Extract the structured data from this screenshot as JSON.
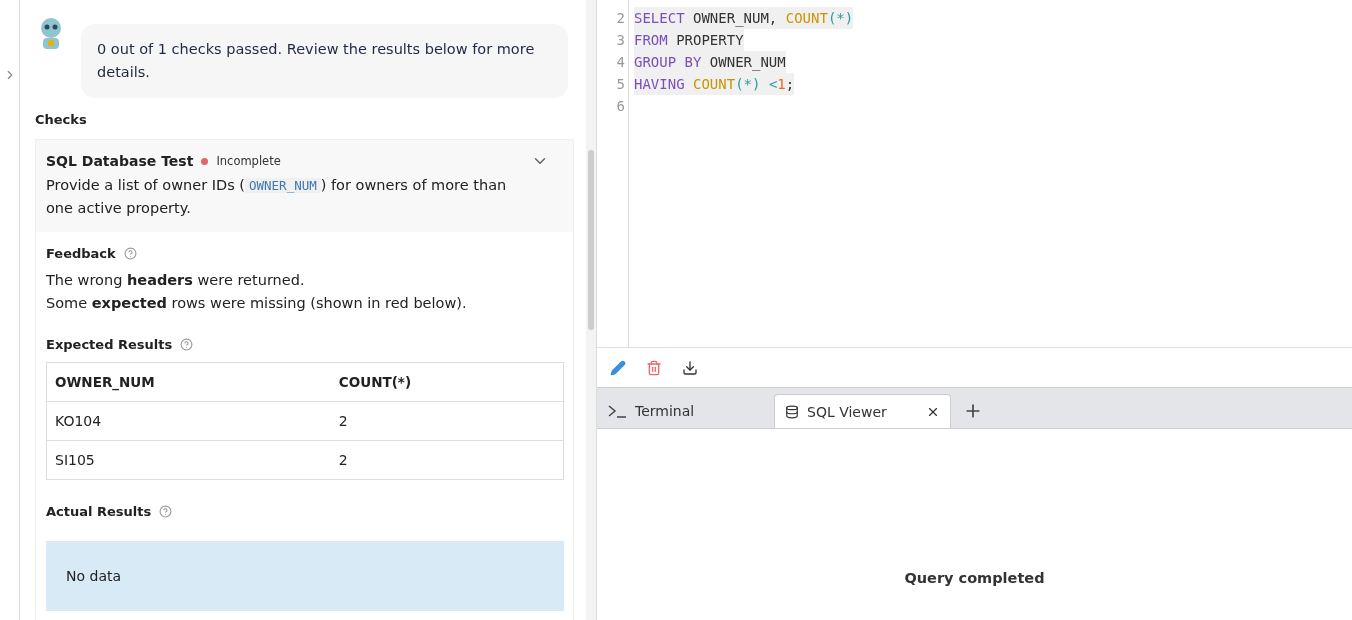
{
  "chat": {
    "message": "0 out of 1 checks passed. Review the results below for more details."
  },
  "checks_heading": "Checks",
  "check": {
    "title": "SQL Database Test",
    "status": "Incomplete",
    "color": "#e5636a",
    "expanded": true,
    "description": [
      {
        "kind": "text",
        "text": "Provide a list of owner IDs ("
      },
      {
        "kind": "code",
        "text": "OWNER_NUM"
      },
      {
        "kind": "text",
        "text": ") for owners of more than one active property."
      }
    ],
    "feedback_label": "Feedback",
    "feedback": [
      "The wrong **headers** were returned.",
      "Some **expected** rows were missing (shown in red below)."
    ],
    "expected_label": "Expected Results",
    "expected": {
      "columns": [
        "OWNER_NUM",
        "COUNT(*)"
      ],
      "rows": [
        [
          "KO104",
          "2"
        ],
        [
          "SI105",
          "2"
        ]
      ]
    },
    "actual_label": "Actual Results",
    "actual_empty": "No data"
  },
  "editor": {
    "lines": [
      {
        "number": "2",
        "tokens": [
          {
            "kind": "keyword",
            "text": "SELECT"
          },
          {
            "kind": "ident",
            "text": " OWNER_NUM, "
          },
          {
            "kind": "func",
            "text": "COUNT"
          },
          {
            "kind": "punct",
            "text": "(*)"
          }
        ]
      },
      {
        "number": "3",
        "tokens": [
          {
            "kind": "keyword",
            "text": "FROM"
          },
          {
            "kind": "ident",
            "text": " PROPERTY"
          }
        ]
      },
      {
        "number": "4",
        "tokens": [
          {
            "kind": "keyword",
            "text": "GROUP BY"
          },
          {
            "kind": "ident",
            "text": " OWNER_NUM"
          }
        ]
      },
      {
        "number": "5",
        "tokens": [
          {
            "kind": "keyword",
            "text": "HAVING "
          },
          {
            "kind": "func",
            "text": "COUNT"
          },
          {
            "kind": "punct",
            "text": "(*) <"
          },
          {
            "kind": "number",
            "text": "1"
          },
          {
            "kind": "ident",
            "text": ";"
          }
        ]
      },
      {
        "number": "6"
      }
    ]
  },
  "tabs": [
    {
      "kind": "terminal",
      "label": "Terminal",
      "selected": false
    },
    {
      "kind": "sql",
      "label": "SQL Viewer",
      "selected": true
    }
  ],
  "output": {
    "message": "Query completed"
  }
}
